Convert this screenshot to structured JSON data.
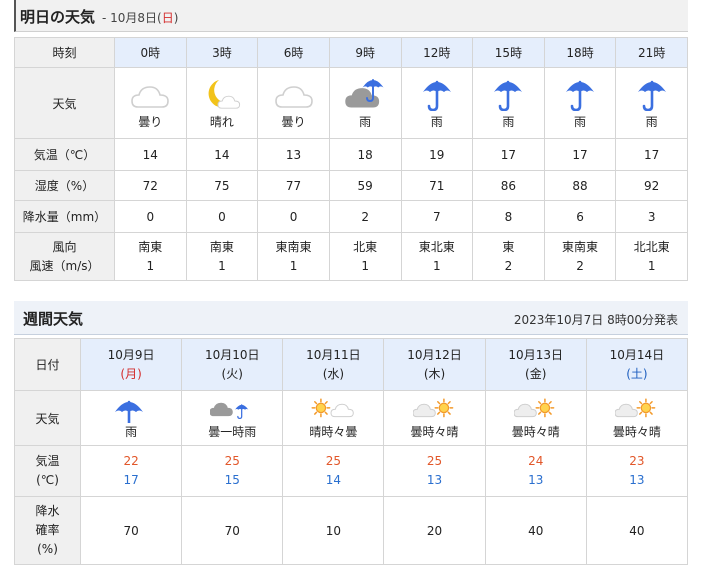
{
  "tomorrow": {
    "title": "明日の天気",
    "date_prefix": " - 10月8日(",
    "date_day": "日",
    "date_suffix": ")",
    "row_labels": {
      "time": "時刻",
      "weather": "天気",
      "temp": "気温（℃）",
      "humidity": "湿度（%）",
      "precip": "降水量（mm）",
      "wind_dir": "風向",
      "wind_speed": "風速（m/s）"
    },
    "hours": [
      {
        "time": "0時",
        "icon": "cloud-icon",
        "cond": "曇り",
        "temp": "14",
        "humidity": "72",
        "precip": "0",
        "wind_dir": "南東",
        "wind_speed": "1"
      },
      {
        "time": "3時",
        "icon": "moon-cloud-icon",
        "cond": "晴れ",
        "temp": "14",
        "humidity": "75",
        "precip": "0",
        "wind_dir": "南東",
        "wind_speed": "1"
      },
      {
        "time": "6時",
        "icon": "cloud-icon",
        "cond": "曇り",
        "temp": "13",
        "humidity": "77",
        "precip": "0",
        "wind_dir": "東南東",
        "wind_speed": "1"
      },
      {
        "time": "9時",
        "icon": "cloud-umbrella-icon",
        "cond": "雨",
        "temp": "18",
        "humidity": "59",
        "precip": "2",
        "wind_dir": "北東",
        "wind_speed": "1"
      },
      {
        "time": "12時",
        "icon": "umbrella-icon",
        "cond": "雨",
        "temp": "19",
        "humidity": "71",
        "precip": "7",
        "wind_dir": "東北東",
        "wind_speed": "1"
      },
      {
        "time": "15時",
        "icon": "umbrella-icon",
        "cond": "雨",
        "temp": "17",
        "humidity": "86",
        "precip": "8",
        "wind_dir": "東",
        "wind_speed": "2"
      },
      {
        "time": "18時",
        "icon": "umbrella-icon",
        "cond": "雨",
        "temp": "17",
        "humidity": "88",
        "precip": "6",
        "wind_dir": "東南東",
        "wind_speed": "2"
      },
      {
        "time": "21時",
        "icon": "umbrella-icon",
        "cond": "雨",
        "temp": "17",
        "humidity": "92",
        "precip": "3",
        "wind_dir": "北北東",
        "wind_speed": "1"
      }
    ]
  },
  "weekly": {
    "title": "週間天気",
    "published": "2023年10月7日 8時00分発表",
    "row_labels": {
      "date": "日付",
      "weather": "天気",
      "temp_1": "気温",
      "temp_2": "(℃)",
      "pop_1": "降水",
      "pop_2": "確率",
      "pop_3": "(%)"
    },
    "days": [
      {
        "date": "10月9日",
        "dow": "(月)",
        "dow_color": "holiday",
        "icon": "umbrella-icon",
        "cond": "雨",
        "high": "22",
        "low": "17",
        "pop": "70"
      },
      {
        "date": "10月10日",
        "dow": "(火)",
        "dow_color": "normal",
        "icon": "cloud-then-rain-icon",
        "cond": "曇一時雨",
        "high": "25",
        "low": "15",
        "pop": "70"
      },
      {
        "date": "10月11日",
        "dow": "(水)",
        "dow_color": "normal",
        "icon": "sun-then-cloud-icon",
        "cond": "晴時々曇",
        "high": "25",
        "low": "14",
        "pop": "10"
      },
      {
        "date": "10月12日",
        "dow": "(木)",
        "dow_color": "normal",
        "icon": "cloud-then-sun-icon",
        "cond": "曇時々晴",
        "high": "25",
        "low": "13",
        "pop": "20"
      },
      {
        "date": "10月13日",
        "dow": "(金)",
        "dow_color": "normal",
        "icon": "cloud-then-sun-icon",
        "cond": "曇時々晴",
        "high": "24",
        "low": "13",
        "pop": "40"
      },
      {
        "date": "10月14日",
        "dow": "(土)",
        "dow_color": "saturday",
        "icon": "cloud-then-sun-icon",
        "cond": "曇時々晴",
        "high": "23",
        "low": "13",
        "pop": "40"
      }
    ]
  },
  "colors": {
    "umbrella": "#3b6fe0",
    "sun": "#f39a2b",
    "moon": "#f2c31a",
    "cloud_light": "#cfcfcf",
    "cloud_dark": "#9a9a9a",
    "holiday": "#d42d2d",
    "saturday": "#1f5fbf",
    "high_temp": "#e2572a",
    "low_temp": "#2a6fcf"
  }
}
